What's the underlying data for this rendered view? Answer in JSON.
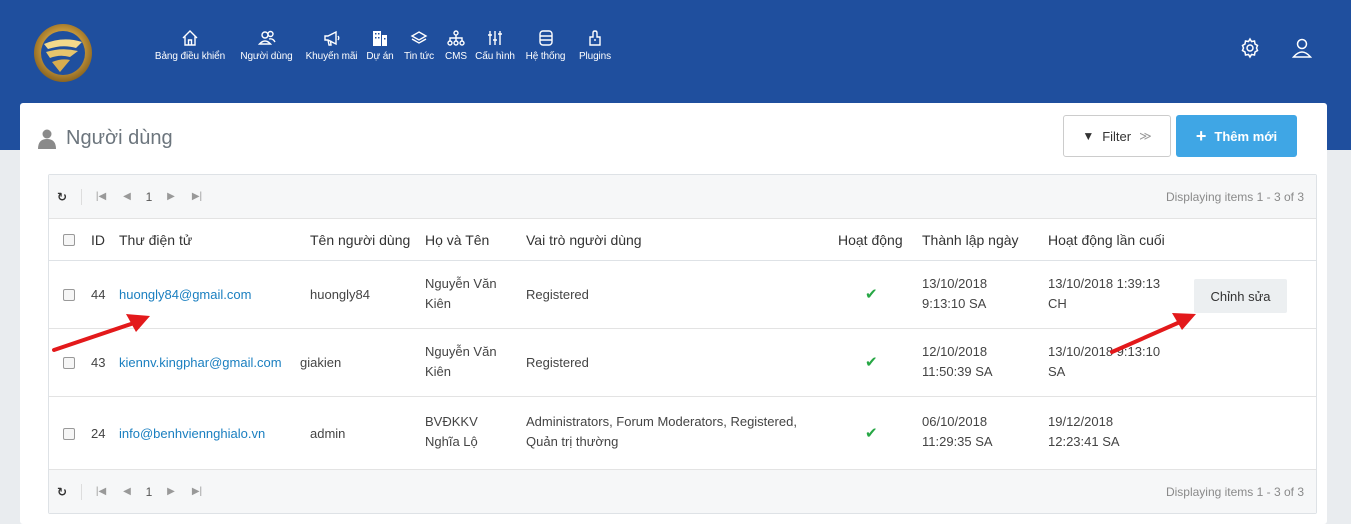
{
  "nav": {
    "items": [
      {
        "label": "Bảng điều khiển",
        "icon": "home-icon"
      },
      {
        "label": "Người dùng",
        "icon": "users-icon"
      },
      {
        "label": "Khuyến mãi",
        "icon": "megaphone-icon"
      },
      {
        "label": "Dự án",
        "icon": "building-icon"
      },
      {
        "label": "Tin tức",
        "icon": "layers-icon"
      },
      {
        "label": "CMS",
        "icon": "sitemap-icon"
      },
      {
        "label": "Cấu hình",
        "icon": "sliders-icon"
      },
      {
        "label": "Hệ thống",
        "icon": "database-icon"
      },
      {
        "label": "Plugins",
        "icon": "plug-icon"
      }
    ]
  },
  "page": {
    "title": "Người dùng"
  },
  "toolbar": {
    "filter_label": "Filter",
    "add_label": "Thêm mới"
  },
  "pager": {
    "page": "1",
    "info": "Displaying items 1 - 3 of 3"
  },
  "table": {
    "columns": {
      "id": "ID",
      "email": "Thư điện tử",
      "username": "Tên người dùng",
      "fullname": "Họ và Tên",
      "roles": "Vai trò người dùng",
      "active": "Hoạt động",
      "created": "Thành lập ngày",
      "last_active": "Hoạt động lần cuối"
    },
    "rows": [
      {
        "id": "44",
        "email": "huongly84@gmail.com",
        "username": "huongly84",
        "name1": "Nguyễn Văn",
        "name2": "Kiên",
        "role1": "Registered",
        "role2": "",
        "created1": "13/10/2018",
        "created2": "9:13:10 SA",
        "last1": "13/10/2018 1:39:13",
        "last2": "CH",
        "active": true,
        "edit_label": "Chỉnh sửa"
      },
      {
        "id": "43",
        "email": "kiennv.kingphar@gmail.com",
        "username": "giakien",
        "name1": "Nguyễn Văn",
        "name2": "Kiên",
        "role1": "Registered",
        "role2": "",
        "created1": "12/10/2018",
        "created2": "11:50:39 SA",
        "last1": "13/10/2018 9:13:10",
        "last2": "SA",
        "active": true
      },
      {
        "id": "24",
        "email": "info@benhviennghialo.vn",
        "username": "admin",
        "name1": "BVĐKKV",
        "name2": "Nghĩa Lộ",
        "role1": "Administrators, Forum Moderators, Registered,",
        "role2": "Quản trị thường",
        "created1": "06/10/2018",
        "created2": "11:29:35 SA",
        "last1": "19/12/2018",
        "last2": "12:23:41 SA",
        "active": true
      }
    ]
  },
  "colors": {
    "header": "#1f4f9e",
    "accent": "#3fa6e5",
    "link": "#1a7fc0",
    "success": "#27a745",
    "annotation": "#e3191b"
  }
}
